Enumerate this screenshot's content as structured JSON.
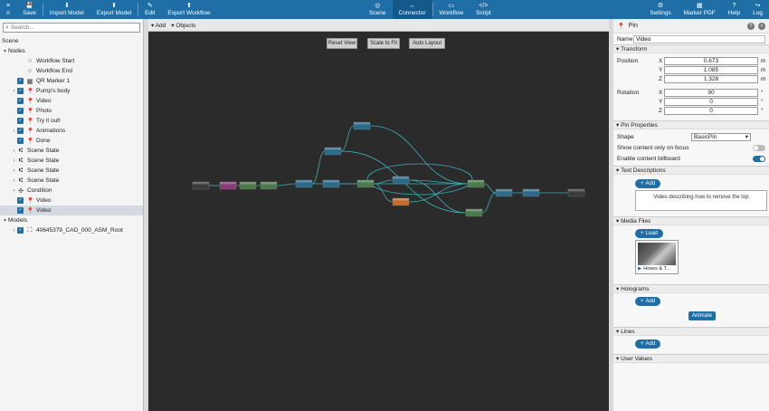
{
  "colors": {
    "brand": "#1f6ea5",
    "canvas": "#2b2b2b",
    "node": "#3a3a3a",
    "node_blue": "#2a6a8a",
    "node_green": "#4a7a4a",
    "node_pink": "#8a3a7a",
    "node_orange": "#c86a2a",
    "edge": "#3ab0b8"
  },
  "toolbar": {
    "left": [
      {
        "icon": "hamburger-icon",
        "glyph": "≡",
        "label": "n"
      },
      {
        "icon": "save-icon",
        "glyph": "💾",
        "label": "Save"
      },
      {
        "icon": "import-icon",
        "glyph": "⬇",
        "label": "Import Model"
      },
      {
        "icon": "export-icon",
        "glyph": "⬆",
        "label": "Export Model"
      },
      {
        "icon": "edit-icon",
        "glyph": "✎",
        "label": "Edit"
      },
      {
        "icon": "export-workflow-icon",
        "glyph": "⬆",
        "label": "Export Workflow"
      }
    ],
    "center": [
      {
        "icon": "scene-icon",
        "glyph": "◎",
        "label": "Scene"
      },
      {
        "icon": "connector-icon",
        "glyph": "↔",
        "label": "Connector"
      },
      {
        "icon": "workflow-icon",
        "glyph": "▭",
        "label": "Workflow"
      },
      {
        "icon": "script-icon",
        "glyph": "</>",
        "label": "Script"
      }
    ],
    "right": [
      {
        "icon": "gear-icon",
        "glyph": "⚙",
        "label": "Settings"
      },
      {
        "icon": "marker-icon",
        "glyph": "▦",
        "label": "Marker PDF"
      },
      {
        "icon": "help-icon",
        "glyph": "?",
        "label": "Help"
      },
      {
        "icon": "logout-icon",
        "glyph": "↪",
        "label": "Log"
      }
    ],
    "edit_caret": "▾",
    "workflow_caret": "▾",
    "marker_caret": "▾",
    "help_caret": "▾"
  },
  "left": {
    "search_placeholder": "Search...",
    "scene_label": "Scene",
    "tree": [
      {
        "label": "Nodes",
        "indent": 0,
        "arrow": "▾",
        "cb": false,
        "icon": ""
      },
      {
        "label": "Workflow Start",
        "indent": 2,
        "arrow": "",
        "cb": false,
        "icon": "○"
      },
      {
        "label": "Workflow End",
        "indent": 2,
        "arrow": "",
        "cb": false,
        "icon": "○"
      },
      {
        "label": "QR Marker 1",
        "indent": 1,
        "arrow": "",
        "cb": true,
        "icon": "▦"
      },
      {
        "label": "Pump's body",
        "indent": 1,
        "arrow": "›",
        "cb": true,
        "icon": "📍"
      },
      {
        "label": "Video",
        "indent": 1,
        "arrow": "",
        "cb": true,
        "icon": "📍"
      },
      {
        "label": "Photo",
        "indent": 1,
        "arrow": "",
        "cb": true,
        "icon": "📍"
      },
      {
        "label": "Try it out!",
        "indent": 1,
        "arrow": "",
        "cb": true,
        "icon": "📍"
      },
      {
        "label": "Animations",
        "indent": 1,
        "arrow": "›",
        "cb": true,
        "icon": "📍"
      },
      {
        "label": "Done",
        "indent": 1,
        "arrow": "",
        "cb": true,
        "icon": "📍"
      },
      {
        "label": "Scene State",
        "indent": 1,
        "arrow": "›",
        "cb": false,
        "icon": "⑆"
      },
      {
        "label": "Scene State",
        "indent": 1,
        "arrow": "›",
        "cb": false,
        "icon": "⑆"
      },
      {
        "label": "Scene State",
        "indent": 1,
        "arrow": "›",
        "cb": false,
        "icon": "⑆"
      },
      {
        "label": "Scene State",
        "indent": 1,
        "arrow": "›",
        "cb": false,
        "icon": "⑆"
      },
      {
        "label": "Condition",
        "indent": 1,
        "arrow": "›",
        "cb": false,
        "icon": "✣"
      },
      {
        "label": "Video",
        "indent": 1,
        "arrow": "",
        "cb": true,
        "icon": "📍"
      },
      {
        "label": "Video",
        "indent": 1,
        "arrow": "",
        "cb": true,
        "icon": "📍",
        "selected": true
      },
      {
        "label": "Models",
        "indent": 0,
        "arrow": "▾",
        "cb": false,
        "icon": ""
      },
      {
        "label": "40645379_CAD_000_ASM_Root",
        "indent": 1,
        "arrow": "›",
        "cb": true,
        "icon": "⛶"
      }
    ]
  },
  "canvas": {
    "add_label": "Add",
    "objects_label": "Objects",
    "reset_view": "Reset View",
    "scale_to_fit": "Scale to Fit",
    "auto_layout": "Auto Layout"
  },
  "right": {
    "title": "Pin",
    "name_label": "Name",
    "name_value": "Video",
    "transform": "Transform",
    "position_label": "Position",
    "position": [
      {
        "axis": "X",
        "value": "0.673",
        "unit": "m"
      },
      {
        "axis": "Y",
        "value": "1.085",
        "unit": "m"
      },
      {
        "axis": "Z",
        "value": "1.328",
        "unit": "m"
      }
    ],
    "rotation_label": "Rotation",
    "rotation": [
      {
        "axis": "X",
        "value": "90",
        "unit": "°"
      },
      {
        "axis": "Y",
        "value": "0",
        "unit": "°"
      },
      {
        "axis": "Z",
        "value": "0",
        "unit": "°"
      }
    ],
    "pin_properties": "Pin Properties",
    "shape_label": "Shape",
    "shape_value": "BasicPin",
    "show_content_label": "Show content only on focus",
    "show_content_on": false,
    "billboard_label": "Enable content billboard",
    "billboard_on": true,
    "text_descriptions": "Text Descriptions",
    "add": "Add",
    "description_text": "Video describing how to remove the top",
    "media_files": "Media Files",
    "load": "Load",
    "media_caption": "Hoses & T...",
    "holograms": "Holograms",
    "animate": "Animate",
    "lines": "Lines",
    "user_values": "User Values"
  }
}
